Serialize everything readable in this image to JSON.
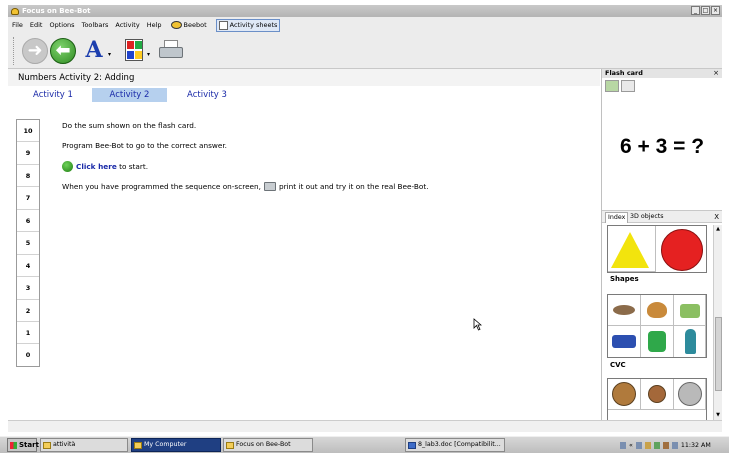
{
  "window": {
    "title": "Focus on Bee-Bot",
    "controls": [
      "_",
      "□",
      "×"
    ]
  },
  "menu": {
    "items": [
      "File",
      "Edit",
      "Options",
      "Toolbars",
      "Activity",
      "Help"
    ],
    "beebot_label": "Beebot",
    "activity_sheets_label": "Activity sheets"
  },
  "toolbar": {
    "forward_icon": "arrow-right-icon",
    "back_icon": "arrow-left-icon",
    "font_glyph": "A"
  },
  "activity": {
    "title": "Numbers Activity 2: Adding",
    "tabs": [
      "Activity 1",
      "Activity 2",
      "Activity 3"
    ],
    "selected_tab": 1,
    "side_values": [
      "10",
      "9",
      "8",
      "7",
      "6",
      "5",
      "4",
      "3",
      "2",
      "1",
      "0"
    ],
    "instructions": {
      "line1": "Do the sum shown on the flash card.",
      "line2": "Program Bee-Bot to go to the correct answer.",
      "line3_link": "Click here",
      "line3_rest": " to start.",
      "line4_a": "When you have programmed the sequence on-screen,",
      "line4_b": "print it out and try it on the real Bee-Bot."
    }
  },
  "flash_card": {
    "header": "Flash card",
    "close": "×",
    "equation": "6 + 3 = ?"
  },
  "index_panel": {
    "tabs": [
      "Index",
      "3D objects"
    ],
    "close": "X",
    "categories": [
      "Shapes",
      "CVC"
    ]
  },
  "taskbar": {
    "start": "Start",
    "tasks": [
      "attività",
      "My Computer",
      "Focus on Bee-Bot",
      "8_lab3.doc [Compatibilit..."
    ],
    "active_task": 1,
    "clock": "11:32 AM"
  },
  "colors": {
    "link": "#1a2aa8",
    "tab_selected_bg": "#b6d0ee",
    "shape_triangle": "#f2e40d",
    "shape_circle": "#e52121"
  }
}
